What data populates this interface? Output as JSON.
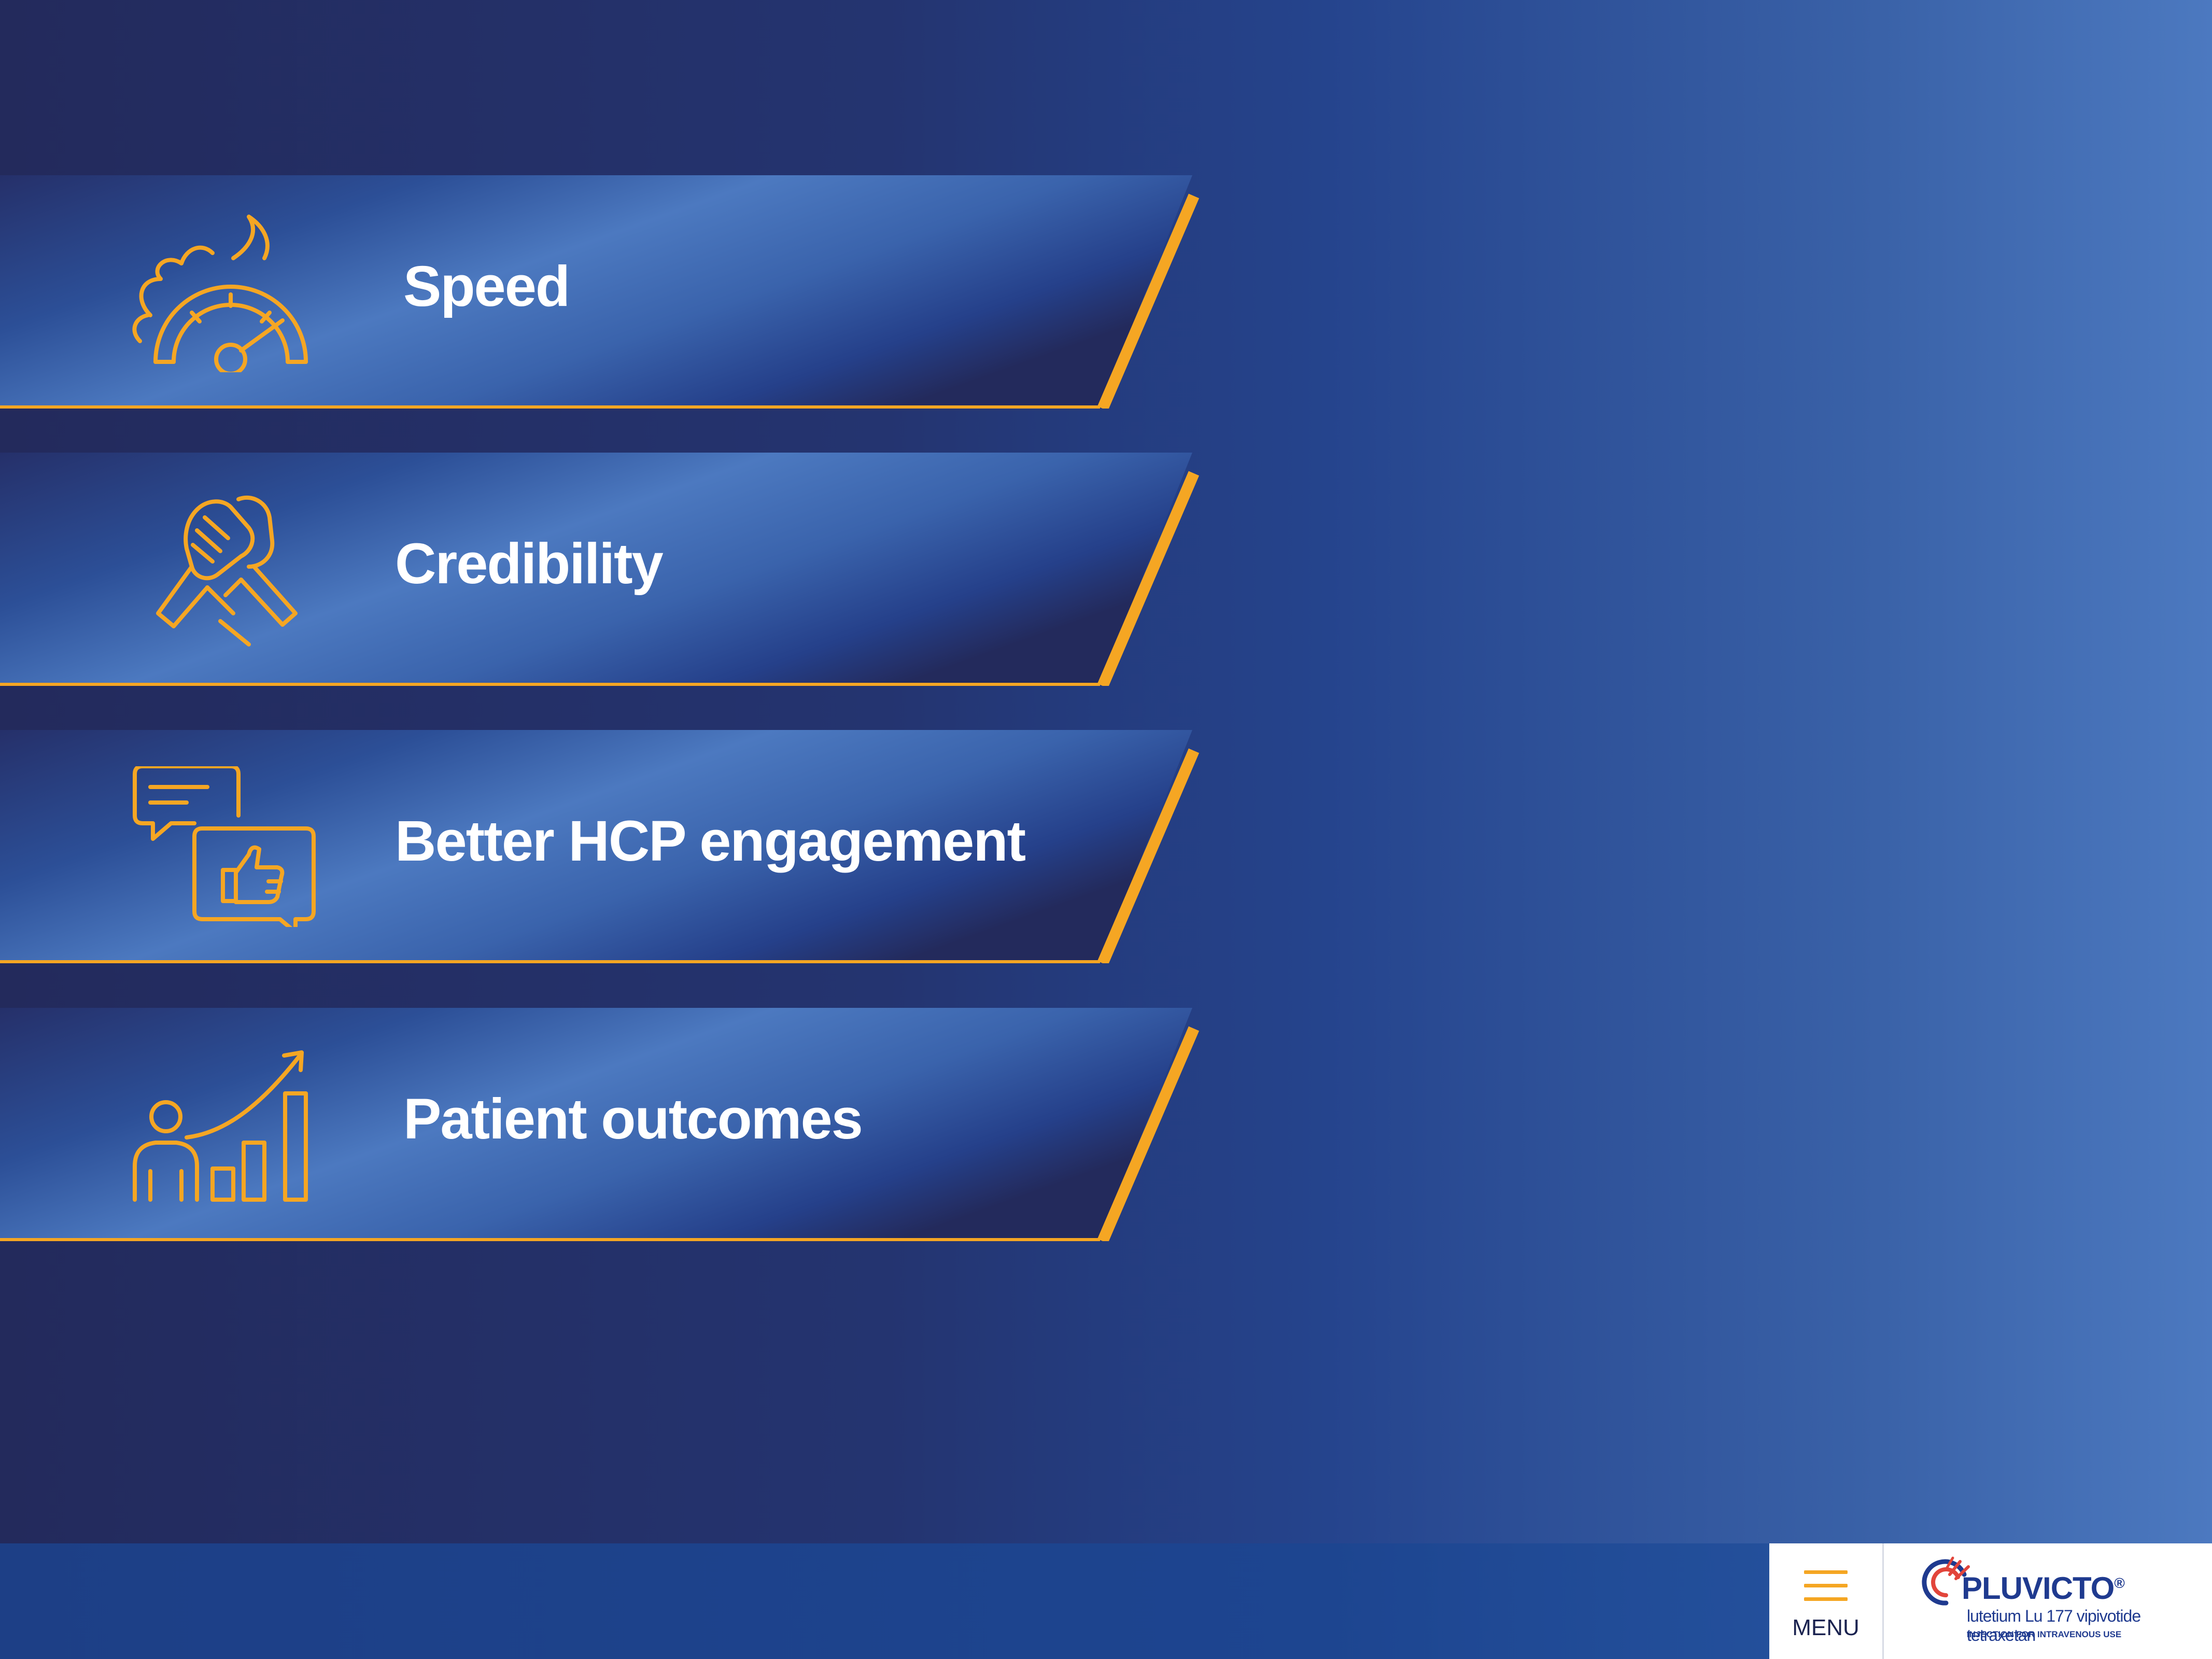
{
  "banners": [
    {
      "label": "Speed",
      "icon": "speedometer-icon"
    },
    {
      "label": "Credibility",
      "icon": "handshake-icon"
    },
    {
      "label": "Better HCP engagement",
      "icon": "chat-thumbs-up-icon"
    },
    {
      "label": "Patient outcomes",
      "icon": "growth-chart-person-icon"
    }
  ],
  "footer": {
    "menu_label": "MENU",
    "brand": {
      "name": "PLUVICTO",
      "registered": "®",
      "subtitle": "lutetium Lu 177 vipivotide tetraxetan",
      "route": "INJECTION FOR INTRAVENOUS USE"
    }
  },
  "colors": {
    "accent": "#f5a623",
    "banner_light": "#4c79c0",
    "banner_dark": "#232a5c",
    "background_right": "#4c79c0"
  }
}
